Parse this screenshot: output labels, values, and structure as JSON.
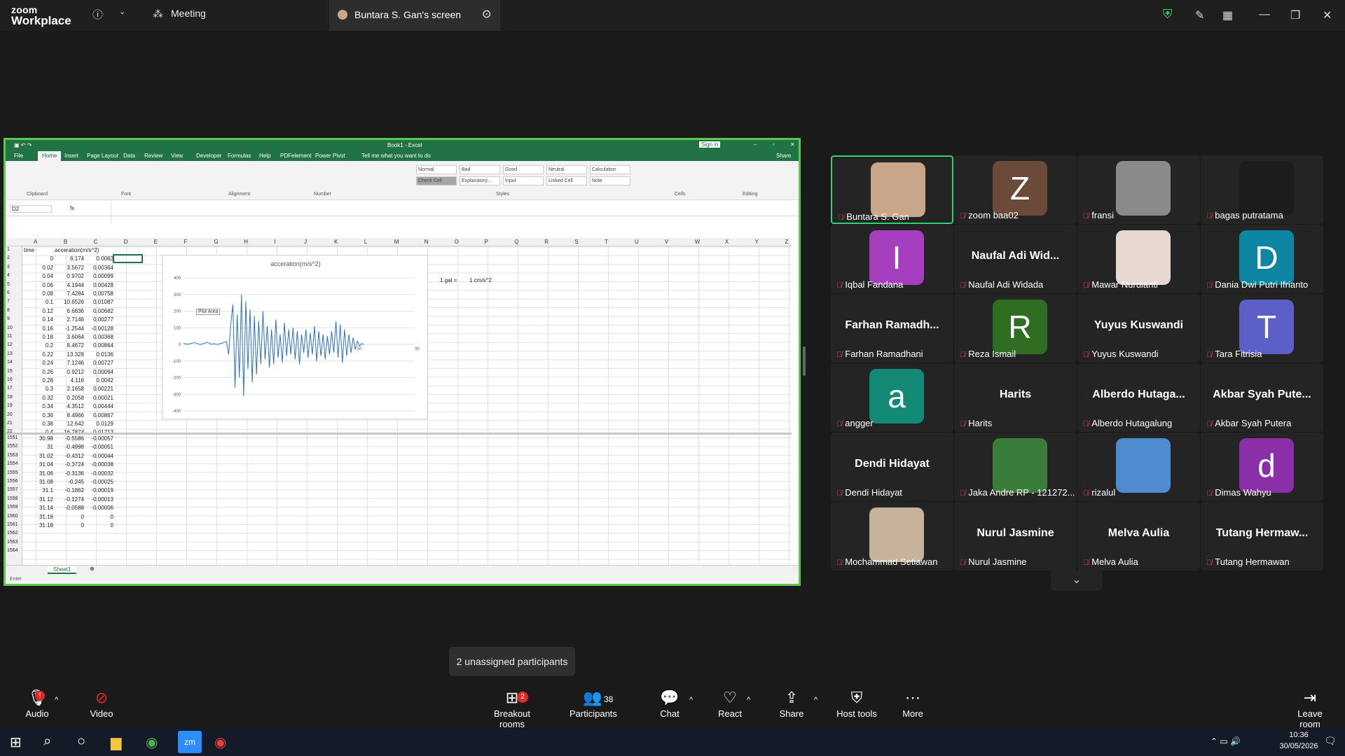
{
  "app": {
    "logo_line1": "zoom",
    "logo_line2": "Workplace"
  },
  "topbar": {
    "meeting_tab": "Meeting",
    "share_tab": "Buntara S. Gan's screen"
  },
  "excel": {
    "title": "Book1 - Excel",
    "sign_in": "Sign in",
    "share": "Share",
    "tabs": [
      "File",
      "Home",
      "Insert",
      "Page Layout",
      "Data",
      "Review",
      "View",
      "Developer",
      "Formulas",
      "Help",
      "PDFelement",
      "Power Pivot"
    ],
    "tell_me": "Tell me what you want to do",
    "ribbon_groups": [
      "Clipboard",
      "Font",
      "Alignment",
      "Number",
      "Styles",
      "Cells",
      "Editing"
    ],
    "styles": [
      "Normal",
      "Bad",
      "Good",
      "Neutral",
      "Calculation",
      "Check Cell",
      "Explanatory...",
      "Input",
      "Linked Cell",
      "Note"
    ],
    "name_box": "D2",
    "fx": "fx",
    "columns": [
      "A",
      "B",
      "C",
      "D",
      "E",
      "F",
      "G",
      "H",
      "I",
      "J",
      "K",
      "L",
      "M",
      "N",
      "O",
      "P",
      "Q",
      "R",
      "S",
      "T",
      "U",
      "V",
      "W",
      "X",
      "Y",
      "Z"
    ],
    "header_row": {
      "a": "time",
      "b": "acceration(m/s^2)"
    },
    "rows_top": [
      {
        "n": "1",
        "a": "time",
        "b": "acceration(m/s^2)",
        "c": ""
      },
      {
        "n": "2",
        "a": "0",
        "b": "6.174",
        "c": "0.0063"
      },
      {
        "n": "3",
        "a": "0.02",
        "b": "3.5672",
        "c": "0.00364"
      },
      {
        "n": "4",
        "a": "0.04",
        "b": "0.9702",
        "c": "0.00099"
      },
      {
        "n": "5",
        "a": "0.06",
        "b": "4.1944",
        "c": "0.00428"
      },
      {
        "n": "6",
        "a": "0.08",
        "b": "7.4284",
        "c": "0.00758"
      },
      {
        "n": "7",
        "a": "0.1",
        "b": "10.6526",
        "c": "0.01087"
      },
      {
        "n": "8",
        "a": "0.12",
        "b": "6.6836",
        "c": "0.00682"
      },
      {
        "n": "9",
        "a": "0.14",
        "b": "2.7146",
        "c": "0.00277"
      },
      {
        "n": "10",
        "a": "0.16",
        "b": "-1.2544",
        "c": "-0.00128"
      },
      {
        "n": "11",
        "a": "0.18",
        "b": "3.6064",
        "c": "0.00368"
      },
      {
        "n": "12",
        "a": "0.2",
        "b": "8.4672",
        "c": "0.00864"
      },
      {
        "n": "13",
        "a": "0.22",
        "b": "13.328",
        "c": "0.0136"
      },
      {
        "n": "14",
        "a": "0.24",
        "b": "7.1246",
        "c": "0.00727"
      },
      {
        "n": "15",
        "a": "0.26",
        "b": "0.9212",
        "c": "0.00094"
      },
      {
        "n": "16",
        "a": "0.28",
        "b": "4.116",
        "c": "0.0042"
      },
      {
        "n": "17",
        "a": "0.3",
        "b": "2.1658",
        "c": "0.00221"
      },
      {
        "n": "18",
        "a": "0.32",
        "b": "0.2058",
        "c": "0.00021"
      },
      {
        "n": "19",
        "a": "0.34",
        "b": "4.3512",
        "c": "0.00444"
      },
      {
        "n": "20",
        "a": "0.36",
        "b": "8.4966",
        "c": "0.00867"
      },
      {
        "n": "21",
        "a": "0.38",
        "b": "12.642",
        "c": "0.0129"
      },
      {
        "n": "22",
        "a": "0.4",
        "b": "16.7874",
        "c": "0.01713"
      }
    ],
    "rows_bottom": [
      {
        "n": "1551",
        "a": "30.98",
        "b": "-0.5586",
        "c": "-0.00057"
      },
      {
        "n": "1552",
        "a": "31",
        "b": "-0.4998",
        "c": "-0.00051"
      },
      {
        "n": "1553",
        "a": "31.02",
        "b": "-0.4312",
        "c": "-0.00044"
      },
      {
        "n": "1554",
        "a": "31.04",
        "b": "-0.3724",
        "c": "-0.00038"
      },
      {
        "n": "1555",
        "a": "31.06",
        "b": "-0.3136",
        "c": "-0.00032"
      },
      {
        "n": "1556",
        "a": "31.08",
        "b": "-0.245",
        "c": "-0.00025"
      },
      {
        "n": "1557",
        "a": "31.1",
        "b": "-0.1862",
        "c": "-0.00019"
      },
      {
        "n": "1558",
        "a": "31.12",
        "b": "-0.1274",
        "c": "-0.00013"
      },
      {
        "n": "1559",
        "a": "31.14",
        "b": "-0.0588",
        "c": "-0.00006"
      },
      {
        "n": "1560",
        "a": "31.16",
        "b": "0",
        "c": "0"
      },
      {
        "n": "1561",
        "a": "31.18",
        "b": "0",
        "c": "0"
      },
      {
        "n": "1562",
        "a": "",
        "b": "",
        "c": ""
      },
      {
        "n": "1563",
        "a": "",
        "b": "",
        "c": ""
      },
      {
        "n": "1564",
        "a": "",
        "b": "",
        "c": ""
      }
    ],
    "note_o3": "1 gal =",
    "note_p3": "1 cm/s^2",
    "sheet_tab": "Sheet1",
    "status": "Enter"
  },
  "chart_data": {
    "type": "line",
    "title": "acceration(m/s^2)",
    "tooltip": "Plot Area",
    "ylim": [
      -400,
      400
    ],
    "yticks": [
      "400",
      "300",
      "200",
      "100",
      "0",
      "-100",
      "-200",
      "-300",
      "-400"
    ],
    "xticks": [
      "30",
      "35"
    ],
    "series": [
      {
        "values": [
          6,
          3,
          1,
          4,
          7,
          11,
          7,
          3,
          -1,
          4,
          8,
          13,
          7,
          1,
          4,
          2,
          0,
          4,
          8,
          13,
          17,
          -60,
          120,
          240,
          -260,
          180,
          -200,
          300,
          -310,
          260,
          -150,
          210,
          -230,
          170,
          -180,
          140,
          -120,
          200,
          -90,
          110,
          -140,
          90,
          -120,
          150,
          -80,
          60,
          -110,
          130,
          -70,
          90,
          -60,
          100,
          -90,
          80,
          -120,
          60,
          -50,
          90,
          -80,
          70,
          -60,
          110,
          -100,
          80,
          -70,
          60,
          -90,
          50,
          -60,
          80,
          -50,
          140,
          -80,
          120,
          -110,
          90,
          -70,
          60,
          -50,
          40,
          -30,
          20,
          -10,
          5,
          0
        ]
      }
    ],
    "colors": {
      "line": "#2f6fc0"
    }
  },
  "participants": [
    {
      "name": "Buntara S. Gan",
      "kind": "photo",
      "active": true
    },
    {
      "name": "zoom baa02",
      "kind": "letter",
      "letter": "Z",
      "color": "#6b4a3a"
    },
    {
      "name": "fransi",
      "kind": "photo"
    },
    {
      "name": "bagas putratama",
      "kind": "photo"
    },
    {
      "name": "Iqbal Fandana",
      "kind": "letter",
      "letter": "I",
      "color": "#a53fbf"
    },
    {
      "name": "Naufal Adi Widada",
      "kind": "text",
      "big": "Naufal Adi Wid..."
    },
    {
      "name": "Mawar Nurdianti",
      "kind": "photo"
    },
    {
      "name": "Dania Dwi Putri Ifrianto",
      "kind": "letter",
      "letter": "D",
      "color": "#0e86a3"
    },
    {
      "name": "Farhan Ramadhani",
      "kind": "text",
      "big": "Farhan Ramadh..."
    },
    {
      "name": "Reza Ismail",
      "kind": "letter",
      "letter": "R",
      "color": "#2f6e22"
    },
    {
      "name": "Yuyus Kuswandi",
      "kind": "text",
      "big": "Yuyus Kuswandi"
    },
    {
      "name": "Tara Fitrisia",
      "kind": "letter",
      "letter": "T",
      "color": "#5b5fc7"
    },
    {
      "name": "angger",
      "kind": "letter",
      "letter": "a",
      "color": "#138a76"
    },
    {
      "name": "Harits",
      "kind": "text",
      "big": "Harits"
    },
    {
      "name": "Alberdo Hutagalung",
      "kind": "text",
      "big": "Alberdo Hutaga..."
    },
    {
      "name": "Akbar Syah Putera",
      "kind": "text",
      "big": "Akbar Syah Pute..."
    },
    {
      "name": "Dendi Hidayat",
      "kind": "text",
      "big": "Dendi Hidayat"
    },
    {
      "name": "Jaka Andre RP - 121272...",
      "kind": "photo"
    },
    {
      "name": "rizalul",
      "kind": "photo"
    },
    {
      "name": "Dimas Wahyu",
      "kind": "letter",
      "letter": "d",
      "color": "#8a2fa8"
    },
    {
      "name": "Mochammad Setiawan",
      "kind": "photo"
    },
    {
      "name": "Nurul Jasmine",
      "kind": "text",
      "big": "Nurul Jasmine"
    },
    {
      "name": "Melva Aulia",
      "kind": "text",
      "big": "Melva Aulia"
    },
    {
      "name": "Tutang Hermawan",
      "kind": "text",
      "big": "Tutang Hermaw..."
    }
  ],
  "tooltip": "2 unassigned participants",
  "toolbar": {
    "audio": "Audio",
    "video": "Video",
    "breakout": "Breakout rooms",
    "breakout_badge": "2",
    "participants": "Participants",
    "participants_count": "38",
    "chat": "Chat",
    "react": "React",
    "share": "Share",
    "host_tools": "Host tools",
    "more": "More",
    "leave": "Leave room",
    "audio_badge": "!"
  },
  "taskbar": {
    "time": "10:36",
    "date": "30/05/2026",
    "notif": "1"
  }
}
